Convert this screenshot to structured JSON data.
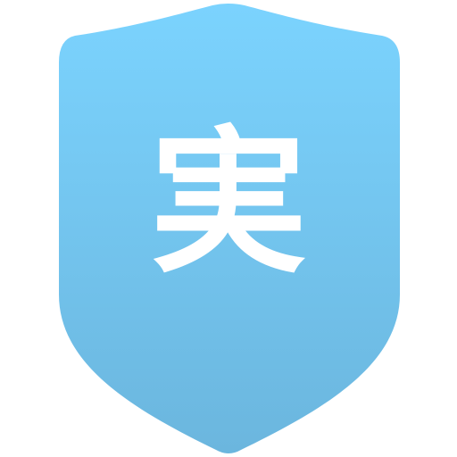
{
  "badge": {
    "character": "実",
    "colors": {
      "shield_top": "#7BD3FE",
      "shield_bottom": "#6BB6DE",
      "glyph": "#FFFFFF"
    }
  }
}
